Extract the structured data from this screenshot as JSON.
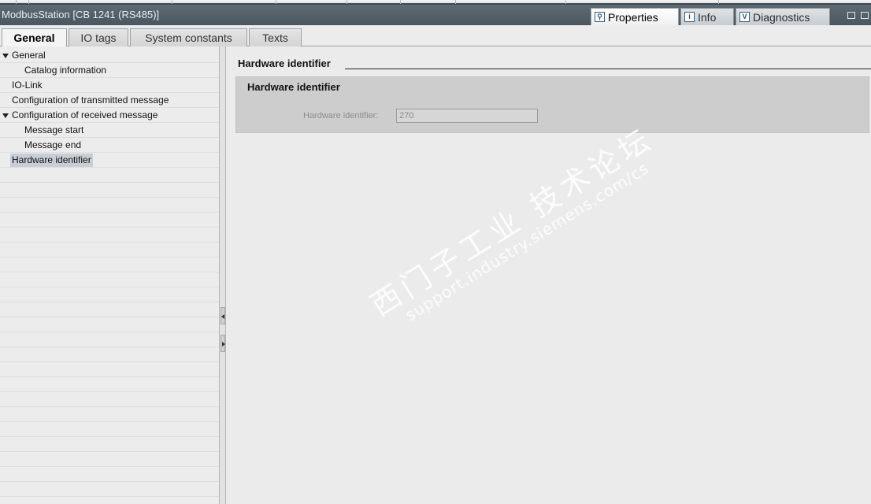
{
  "window": {
    "title": "ModbusStation [CB 1241 (RS485)]"
  },
  "inspector_tabs": [
    {
      "label": "Properties",
      "icon": "properties-icon",
      "active": true
    },
    {
      "label": "Info",
      "icon": "info-icon",
      "active": false
    },
    {
      "label": "Diagnostics",
      "icon": "diagnostics-icon",
      "active": false
    }
  ],
  "tabs": [
    {
      "label": "General",
      "active": true
    },
    {
      "label": "IO tags",
      "active": false
    },
    {
      "label": "System constants",
      "active": false
    },
    {
      "label": "Texts",
      "active": false
    }
  ],
  "tree": [
    {
      "label": "General",
      "expanded": true,
      "level": 0
    },
    {
      "label": "Catalog information",
      "level": 1
    },
    {
      "label": "IO-Link",
      "level": 0
    },
    {
      "label": "Configuration of transmitted message",
      "level": 0
    },
    {
      "label": "Configuration of received message",
      "expanded": true,
      "level": 0
    },
    {
      "label": "Message start",
      "level": 1
    },
    {
      "label": "Message end",
      "level": 1
    },
    {
      "label": "Hardware identifier",
      "level": 0,
      "selected": true
    }
  ],
  "content": {
    "section_title": "Hardware identifier",
    "panel_title": "Hardware identifier",
    "field_label": "Hardware identifier:",
    "field_value": "270"
  },
  "watermark": {
    "line1": "西门子工业 技术论坛",
    "line2": "support.industry.siemens.com/cs"
  },
  "colors": {
    "titlebar": "#4e5b64",
    "selection": "#c8ced6",
    "panel": "#cdcdcd"
  }
}
